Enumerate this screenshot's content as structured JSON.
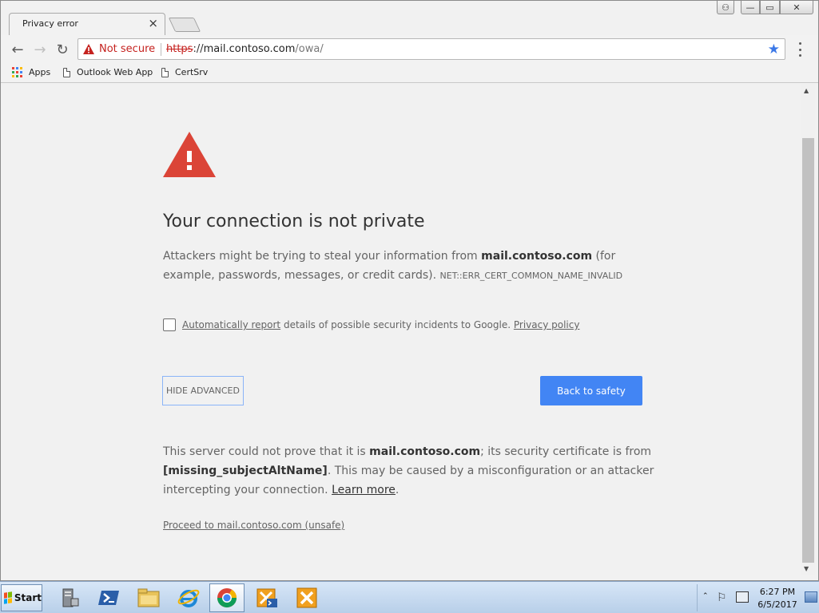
{
  "browser": {
    "tab": {
      "title": "Privacy error",
      "close_glyph": "×"
    },
    "window_controls": {
      "user": "⚇",
      "minimize": "—",
      "maximize": "▭",
      "close": "✕"
    },
    "toolbar": {
      "back_glyph": "←",
      "forward_glyph": "→",
      "reload_glyph": "↻",
      "security_label": "Not secure",
      "url_scheme": "https",
      "url_sep": "://",
      "url_host": "mail.contoso.com",
      "url_path": "/owa/",
      "star_glyph": "★"
    },
    "bookmarks": [
      {
        "label": "Apps",
        "icon": "apps-grid-icon"
      },
      {
        "label": "Outlook Web App",
        "icon": "page-icon"
      },
      {
        "label": "CertSrv",
        "icon": "page-icon"
      }
    ]
  },
  "interstitial": {
    "headline": "Your connection is not private",
    "desc_before": "Attackers might be trying to steal your information from ",
    "desc_host": "mail.contoso.com",
    "desc_after": " (for example, passwords, messages, or credit cards). ",
    "error_code": "NET::ERR_CERT_COMMON_NAME_INVALID",
    "report_link": "Automatically report",
    "report_text": " details of possible security incidents to Google. ",
    "privacy_link": "Privacy policy",
    "hide_advanced": "HIDE ADVANCED",
    "back_to_safety": "Back to safety",
    "details_before": "This server could not prove that it is ",
    "details_host": "mail.contoso.com",
    "details_mid": "; its security certificate is from ",
    "details_issuer": "[missing_subjectAltName]",
    "details_after": ". This may be caused by a misconfiguration or an attacker intercepting your connection. ",
    "learn_more": "Learn more",
    "learn_more_suffix": ".",
    "proceed": "Proceed to mail.contoso.com (unsafe)"
  },
  "taskbar": {
    "start_label": "Start",
    "apps": [
      "server-manager-icon",
      "powershell-icon",
      "file-explorer-icon",
      "internet-explorer-icon",
      "chrome-icon",
      "exchange-shell-icon",
      "exchange-toolbox-icon"
    ],
    "active_app": "chrome-icon",
    "clock_time": "6:27 PM",
    "clock_date": "6/5/2017"
  },
  "colors": {
    "warning_red": "#d93025",
    "link_blue": "#4285f4",
    "text_grey": "#646464"
  }
}
